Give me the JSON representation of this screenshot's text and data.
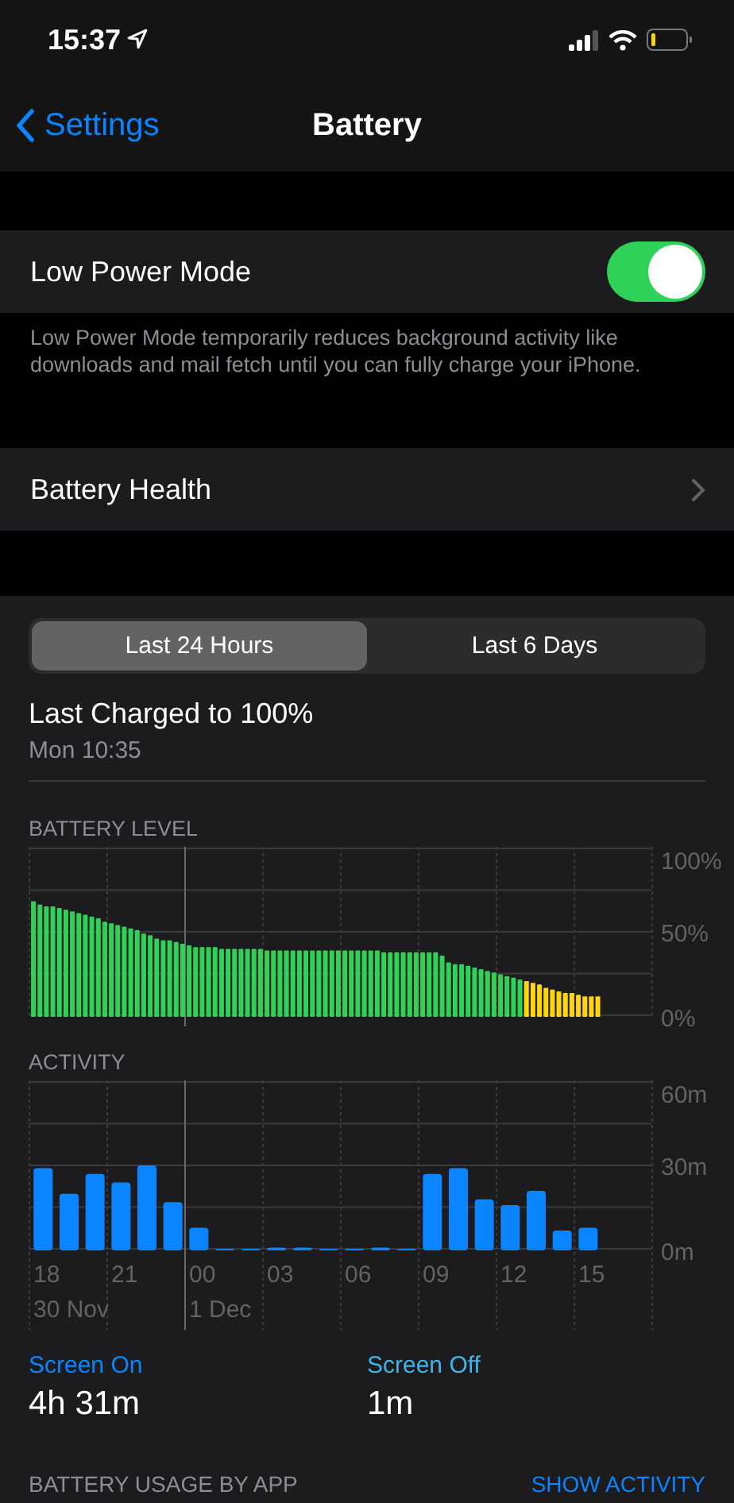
{
  "status_bar": {
    "time": "15:37"
  },
  "nav": {
    "back": "Settings",
    "title": "Battery"
  },
  "low_power": {
    "label": "Low Power Mode",
    "on": true,
    "footer": "Low Power Mode temporarily reduces background activity like downloads and mail fetch until you can fully charge your iPhone."
  },
  "battery_health": {
    "label": "Battery Health"
  },
  "tabs": [
    {
      "label": "Last 24 Hours",
      "selected": true
    },
    {
      "label": "Last 6 Days",
      "selected": false
    }
  ],
  "last_charged": {
    "title": "Last Charged to 100%",
    "time": "Mon 10:35"
  },
  "battery_level": {
    "label": "BATTERY LEVEL",
    "chart_data": {
      "type": "bar",
      "ylim": [
        0,
        100
      ],
      "yticks": [
        {
          "value": 100,
          "label": "100%"
        },
        {
          "value": 50,
          "label": "50%"
        },
        {
          "value": 0,
          "label": "0%"
        }
      ],
      "series": [
        {
          "color": "#30d158",
          "values": [
            68,
            66,
            65,
            65,
            64,
            63,
            62,
            61,
            60,
            59,
            58,
            56,
            55,
            54,
            53,
            52,
            51,
            49,
            48,
            46,
            45,
            45,
            44,
            43,
            42,
            41,
            41,
            41,
            41,
            40,
            40,
            40,
            40,
            40,
            40,
            40,
            39,
            39,
            39,
            39,
            39,
            39,
            39,
            39,
            39,
            39,
            39,
            39,
            39,
            39,
            39,
            39,
            39,
            39,
            38,
            38,
            38,
            38,
            38,
            38,
            38,
            38,
            38,
            36,
            32,
            31,
            31,
            30,
            29,
            28,
            27,
            26,
            25,
            24,
            23,
            22,
            null,
            null,
            null,
            null,
            null,
            null,
            null,
            null,
            null,
            null,
            null,
            null,
            null,
            null,
            null,
            null,
            null,
            null,
            null,
            null
          ]
        },
        {
          "color": "#ffd60a",
          "values": [
            null,
            null,
            null,
            null,
            null,
            null,
            null,
            null,
            null,
            null,
            null,
            null,
            null,
            null,
            null,
            null,
            null,
            null,
            null,
            null,
            null,
            null,
            null,
            null,
            null,
            null,
            null,
            null,
            null,
            null,
            null,
            null,
            null,
            null,
            null,
            null,
            null,
            null,
            null,
            null,
            null,
            null,
            null,
            null,
            null,
            null,
            null,
            null,
            null,
            null,
            null,
            null,
            null,
            null,
            null,
            null,
            null,
            null,
            null,
            null,
            null,
            null,
            null,
            null,
            null,
            null,
            null,
            null,
            null,
            null,
            null,
            null,
            null,
            null,
            null,
            null,
            21,
            20,
            19,
            17,
            16,
            15,
            14,
            14,
            13,
            12,
            12,
            12,
            null,
            null,
            null,
            null,
            null,
            null,
            null,
            null
          ]
        }
      ]
    }
  },
  "activity": {
    "label": "ACTIVITY",
    "chart_data": {
      "type": "bar",
      "ylim": [
        0,
        60
      ],
      "yticks": [
        {
          "value": 60,
          "label": "60m"
        },
        {
          "value": 30,
          "label": "30m"
        },
        {
          "value": 0,
          "label": "0m"
        }
      ],
      "categories": [
        "18",
        null,
        null,
        "21",
        null,
        null,
        "00",
        null,
        null,
        "03",
        null,
        null,
        "06",
        null,
        null,
        "09",
        null,
        null,
        "12",
        null,
        null,
        "15",
        null,
        null
      ],
      "series": [
        {
          "color": "#0a84ff",
          "values": [
            29,
            20,
            27,
            24,
            30,
            17,
            8,
            0,
            0,
            1,
            1,
            0,
            0,
            1,
            0,
            27,
            29,
            18,
            16,
            21,
            7,
            8,
            null,
            null
          ]
        }
      ]
    }
  },
  "dates": [
    "30 Nov",
    "1 Dec"
  ],
  "screen": [
    {
      "label": "Screen On",
      "value": "4h 31m",
      "color": "#0a84ff"
    },
    {
      "label": "Screen Off",
      "value": "1m",
      "color": "#40b4e8"
    }
  ],
  "usage": {
    "title": "BATTERY USAGE BY APP",
    "action": "SHOW ACTIVITY"
  }
}
